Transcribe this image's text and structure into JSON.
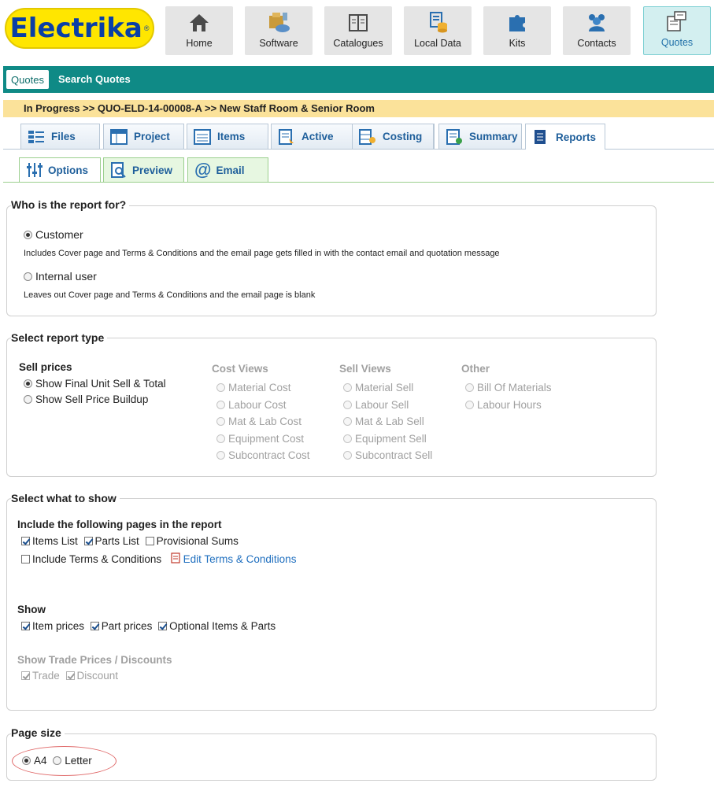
{
  "app": {
    "logo_text": "Electrika",
    "logo_mark": "®"
  },
  "nav": [
    {
      "label": "Home",
      "icon": "home-icon"
    },
    {
      "label": "Software",
      "icon": "software-icon"
    },
    {
      "label": "Catalogues",
      "icon": "book-icon"
    },
    {
      "label": "Local Data",
      "icon": "database-icon"
    },
    {
      "label": "Kits",
      "icon": "puzzle-icon"
    },
    {
      "label": "Contacts",
      "icon": "contacts-icon"
    },
    {
      "label": "Quotes",
      "icon": "quotes-icon",
      "active": true
    }
  ],
  "toolbar": {
    "quotes": "Quotes",
    "search": "Search Quotes"
  },
  "breadcrumb": "In Progress >> QUO-ELD-14-00008-A >> New Staff Room & Senior Room",
  "tabs": [
    {
      "label": "Files",
      "icon": "files-icon"
    },
    {
      "label": "Project",
      "icon": "project-icon"
    },
    {
      "label": "Items",
      "icon": "items-icon"
    },
    {
      "label": "Active",
      "icon": "active-icon"
    },
    {
      "label": "Costing",
      "icon": "costing-icon"
    },
    {
      "label": "Summary",
      "icon": "summary-icon"
    },
    {
      "label": "Reports",
      "icon": "reports-icon",
      "active": true
    }
  ],
  "subtabs": [
    {
      "label": "Options",
      "icon": "sliders-icon",
      "active": true
    },
    {
      "label": "Preview",
      "icon": "preview-icon"
    },
    {
      "label": "Email",
      "icon": "at-icon"
    }
  ],
  "who": {
    "legend": "Who is the report for?",
    "customer": "Customer",
    "customer_desc": "Includes Cover page and Terms & Conditions and the email page gets filled in with the contact email and quotation message",
    "internal": "Internal user",
    "internal_desc": "Leaves out Cover page and Terms & Conditions and the email page is blank"
  },
  "type": {
    "legend": "Select report type",
    "sell_prices": "Sell prices",
    "final": "Show Final Unit Sell & Total",
    "buildup": "Show Sell Price Buildup",
    "cost_views": "Cost Views",
    "cost": [
      "Material Cost",
      "Labour Cost",
      "Mat & Lab Cost",
      "Equipment Cost",
      "Subcontract Cost"
    ],
    "sell_views": "Sell Views",
    "sell": [
      "Material Sell",
      "Labour Sell",
      "Mat & Lab Sell",
      "Equipment Sell",
      "Subcontract Sell"
    ],
    "other": "Other",
    "others": [
      "Bill Of Materials",
      "Labour Hours"
    ]
  },
  "show": {
    "legend": "Select what to show",
    "include_heading": "Include the following pages in the report",
    "items_list": "Items List",
    "parts_list": "Parts List",
    "provisional": "Provisional Sums",
    "terms": "Include Terms & Conditions",
    "edit_terms": "Edit Terms & Conditions",
    "show_heading": "Show",
    "item_prices": "Item prices",
    "part_prices": "Part prices",
    "optional": "Optional Items & Parts",
    "trade_heading": "Show Trade Prices / Discounts",
    "trade": "Trade",
    "discount": "Discount"
  },
  "page_size": {
    "legend": "Page size",
    "a4": "A4",
    "letter": "Letter"
  }
}
